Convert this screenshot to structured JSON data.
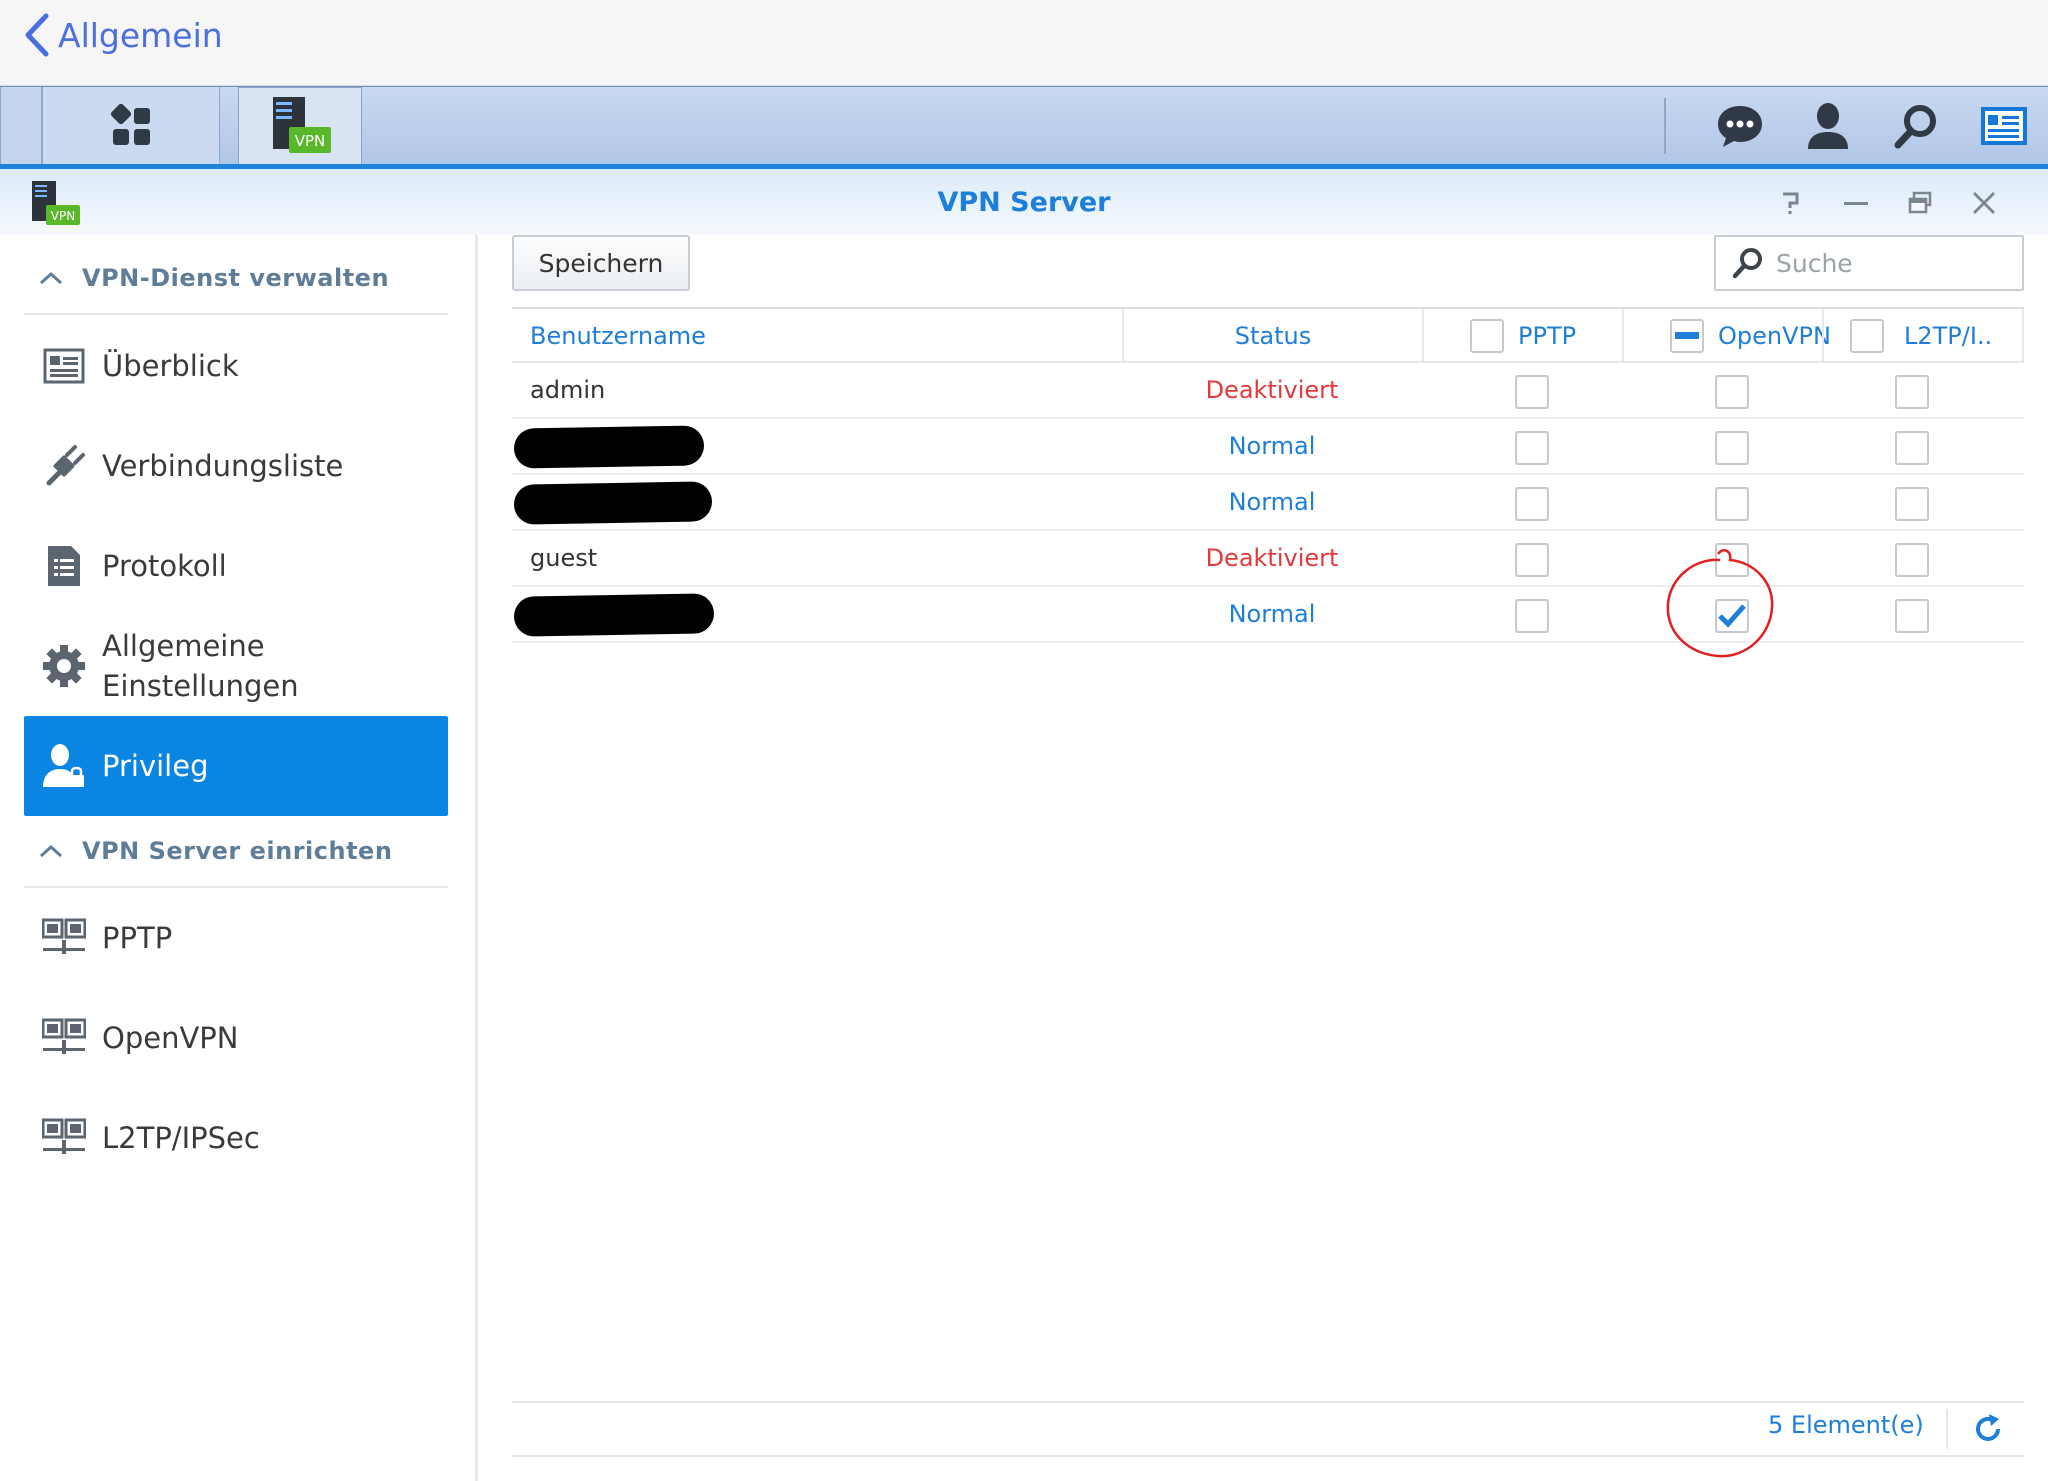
{
  "nav": {
    "back_label": "Allgemein"
  },
  "taskbar": {
    "home_icon": "main-menu-icon",
    "vpn_badge": "VPN",
    "icons": [
      "chat-icon",
      "user-icon",
      "search-icon",
      "widgets-icon"
    ]
  },
  "window": {
    "title": "VPN Server",
    "logo_badge": "VPN",
    "controls": [
      "help-icon",
      "minimize-icon",
      "restore-icon",
      "close-icon"
    ]
  },
  "sidebar": {
    "section1": "VPN-Dienst verwalten",
    "items1": [
      {
        "label": "Überblick",
        "icon": "overview-icon"
      },
      {
        "label": "Verbindungsliste",
        "icon": "plug-icon"
      },
      {
        "label": "Protokoll",
        "icon": "log-icon"
      },
      {
        "label": "Allgemeine Einstellungen",
        "icon": "gear-icon"
      },
      {
        "label": "Privileg",
        "icon": "privilege-icon",
        "active": true
      }
    ],
    "section2": "VPN Server einrichten",
    "items2": [
      {
        "label": "PPTP",
        "icon": "network-icon"
      },
      {
        "label": "OpenVPN",
        "icon": "network-icon"
      },
      {
        "label": "L2TP/IPSec",
        "icon": "network-icon"
      }
    ]
  },
  "toolbar": {
    "save_label": "Speichern",
    "search_placeholder": "Suche"
  },
  "table": {
    "columns": {
      "username": "Benutzername",
      "status": "Status",
      "pptp": "PPTP",
      "openvpn": "OpenVPN",
      "l2tp": "L2TP/I.."
    },
    "header_checks": {
      "pptp": "unchecked",
      "openvpn": "indeterminate",
      "l2tp": "unchecked"
    },
    "rows": [
      {
        "user": "admin",
        "status": "Deaktiviert",
        "pptp": false,
        "openvpn": false,
        "l2tp": false
      },
      {
        "user": "",
        "redacted": true,
        "status": "Normal",
        "pptp": false,
        "openvpn": false,
        "l2tp": false
      },
      {
        "user": "",
        "redacted": true,
        "status": "Normal",
        "pptp": false,
        "openvpn": false,
        "l2tp": false
      },
      {
        "user": "guest",
        "status": "Deaktiviert",
        "pptp": false,
        "openvpn": false,
        "l2tp": false
      },
      {
        "user": "",
        "redacted": true,
        "status": "Normal",
        "pptp": false,
        "openvpn": true,
        "l2tp": false
      }
    ]
  },
  "footer": {
    "count": "5 Element(e)"
  },
  "colors": {
    "accent": "#1e7fd8",
    "active_nav": "#0a85e2",
    "disabled_status": "#e4393c",
    "annotation": "#e02020"
  }
}
